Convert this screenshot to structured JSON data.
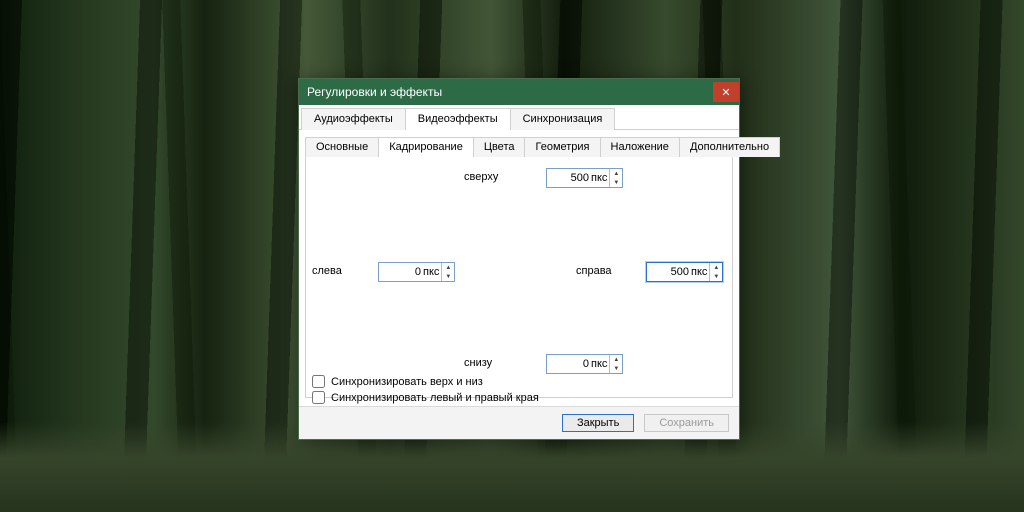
{
  "window": {
    "title": "Регулировки и эффекты",
    "close_icon": "✕"
  },
  "main_tabs": {
    "audio": "Аудиоэффекты",
    "video": "Видеоэффекты",
    "sync": "Синхронизация"
  },
  "sub_tabs": {
    "basic": "Основные",
    "crop": "Кадрирование",
    "colors": "Цвета",
    "geometry": "Геометрия",
    "overlay": "Наложение",
    "advanced": "Дополнительно"
  },
  "crop": {
    "top_label": "сверху",
    "top_value": "500",
    "left_label": "слева",
    "left_value": "0",
    "right_label": "справа",
    "right_value": "500",
    "bottom_label": "снизу",
    "bottom_value": "0",
    "unit": "пкс",
    "sync_tb": "Синхронизировать верх и низ",
    "sync_lr": "Синхронизировать левый и правый края"
  },
  "footer": {
    "close": "Закрыть",
    "save": "Сохранить"
  }
}
